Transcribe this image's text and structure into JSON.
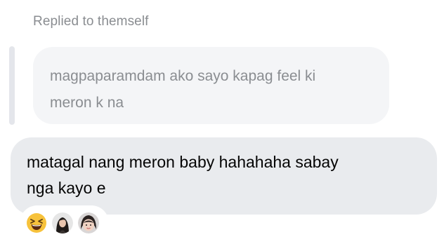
{
  "reply_context": {
    "label": "Replied to themself"
  },
  "quoted_message": {
    "text": "magpaparamdam ako sayo kapag feel ki\nmeron k na"
  },
  "message": {
    "text": "matagal nang meron baby hahahaha sabay\nnga kayo e"
  },
  "reactions": [
    {
      "type": "emoji",
      "icon": "laughing-emoji-icon"
    },
    {
      "type": "avatar",
      "icon": "user-avatar"
    },
    {
      "type": "avatar",
      "icon": "user-avatar"
    }
  ],
  "colors": {
    "quoted_bubble_bg": "#f4f5f7",
    "message_bubble_bg": "#e9ebee",
    "muted_text": "#8a8d91",
    "primary_text": "#050505",
    "emoji_yellow": "#f7c23b"
  }
}
